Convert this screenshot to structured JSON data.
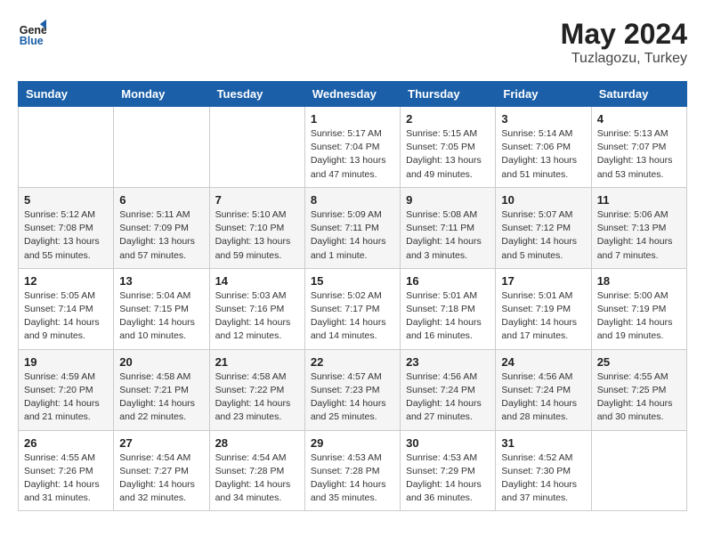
{
  "header": {
    "logo_line1": "General",
    "logo_line2": "Blue",
    "month": "May 2024",
    "location": "Tuzlagozu, Turkey"
  },
  "weekdays": [
    "Sunday",
    "Monday",
    "Tuesday",
    "Wednesday",
    "Thursday",
    "Friday",
    "Saturday"
  ],
  "weeks": [
    [
      {
        "day": "",
        "sunrise": "",
        "sunset": "",
        "daylight": ""
      },
      {
        "day": "",
        "sunrise": "",
        "sunset": "",
        "daylight": ""
      },
      {
        "day": "",
        "sunrise": "",
        "sunset": "",
        "daylight": ""
      },
      {
        "day": "1",
        "sunrise": "Sunrise: 5:17 AM",
        "sunset": "Sunset: 7:04 PM",
        "daylight": "Daylight: 13 hours and 47 minutes."
      },
      {
        "day": "2",
        "sunrise": "Sunrise: 5:15 AM",
        "sunset": "Sunset: 7:05 PM",
        "daylight": "Daylight: 13 hours and 49 minutes."
      },
      {
        "day": "3",
        "sunrise": "Sunrise: 5:14 AM",
        "sunset": "Sunset: 7:06 PM",
        "daylight": "Daylight: 13 hours and 51 minutes."
      },
      {
        "day": "4",
        "sunrise": "Sunrise: 5:13 AM",
        "sunset": "Sunset: 7:07 PM",
        "daylight": "Daylight: 13 hours and 53 minutes."
      }
    ],
    [
      {
        "day": "5",
        "sunrise": "Sunrise: 5:12 AM",
        "sunset": "Sunset: 7:08 PM",
        "daylight": "Daylight: 13 hours and 55 minutes."
      },
      {
        "day": "6",
        "sunrise": "Sunrise: 5:11 AM",
        "sunset": "Sunset: 7:09 PM",
        "daylight": "Daylight: 13 hours and 57 minutes."
      },
      {
        "day": "7",
        "sunrise": "Sunrise: 5:10 AM",
        "sunset": "Sunset: 7:10 PM",
        "daylight": "Daylight: 13 hours and 59 minutes."
      },
      {
        "day": "8",
        "sunrise": "Sunrise: 5:09 AM",
        "sunset": "Sunset: 7:11 PM",
        "daylight": "Daylight: 14 hours and 1 minute."
      },
      {
        "day": "9",
        "sunrise": "Sunrise: 5:08 AM",
        "sunset": "Sunset: 7:11 PM",
        "daylight": "Daylight: 14 hours and 3 minutes."
      },
      {
        "day": "10",
        "sunrise": "Sunrise: 5:07 AM",
        "sunset": "Sunset: 7:12 PM",
        "daylight": "Daylight: 14 hours and 5 minutes."
      },
      {
        "day": "11",
        "sunrise": "Sunrise: 5:06 AM",
        "sunset": "Sunset: 7:13 PM",
        "daylight": "Daylight: 14 hours and 7 minutes."
      }
    ],
    [
      {
        "day": "12",
        "sunrise": "Sunrise: 5:05 AM",
        "sunset": "Sunset: 7:14 PM",
        "daylight": "Daylight: 14 hours and 9 minutes."
      },
      {
        "day": "13",
        "sunrise": "Sunrise: 5:04 AM",
        "sunset": "Sunset: 7:15 PM",
        "daylight": "Daylight: 14 hours and 10 minutes."
      },
      {
        "day": "14",
        "sunrise": "Sunrise: 5:03 AM",
        "sunset": "Sunset: 7:16 PM",
        "daylight": "Daylight: 14 hours and 12 minutes."
      },
      {
        "day": "15",
        "sunrise": "Sunrise: 5:02 AM",
        "sunset": "Sunset: 7:17 PM",
        "daylight": "Daylight: 14 hours and 14 minutes."
      },
      {
        "day": "16",
        "sunrise": "Sunrise: 5:01 AM",
        "sunset": "Sunset: 7:18 PM",
        "daylight": "Daylight: 14 hours and 16 minutes."
      },
      {
        "day": "17",
        "sunrise": "Sunrise: 5:01 AM",
        "sunset": "Sunset: 7:19 PM",
        "daylight": "Daylight: 14 hours and 17 minutes."
      },
      {
        "day": "18",
        "sunrise": "Sunrise: 5:00 AM",
        "sunset": "Sunset: 7:19 PM",
        "daylight": "Daylight: 14 hours and 19 minutes."
      }
    ],
    [
      {
        "day": "19",
        "sunrise": "Sunrise: 4:59 AM",
        "sunset": "Sunset: 7:20 PM",
        "daylight": "Daylight: 14 hours and 21 minutes."
      },
      {
        "day": "20",
        "sunrise": "Sunrise: 4:58 AM",
        "sunset": "Sunset: 7:21 PM",
        "daylight": "Daylight: 14 hours and 22 minutes."
      },
      {
        "day": "21",
        "sunrise": "Sunrise: 4:58 AM",
        "sunset": "Sunset: 7:22 PM",
        "daylight": "Daylight: 14 hours and 23 minutes."
      },
      {
        "day": "22",
        "sunrise": "Sunrise: 4:57 AM",
        "sunset": "Sunset: 7:23 PM",
        "daylight": "Daylight: 14 hours and 25 minutes."
      },
      {
        "day": "23",
        "sunrise": "Sunrise: 4:56 AM",
        "sunset": "Sunset: 7:24 PM",
        "daylight": "Daylight: 14 hours and 27 minutes."
      },
      {
        "day": "24",
        "sunrise": "Sunrise: 4:56 AM",
        "sunset": "Sunset: 7:24 PM",
        "daylight": "Daylight: 14 hours and 28 minutes."
      },
      {
        "day": "25",
        "sunrise": "Sunrise: 4:55 AM",
        "sunset": "Sunset: 7:25 PM",
        "daylight": "Daylight: 14 hours and 30 minutes."
      }
    ],
    [
      {
        "day": "26",
        "sunrise": "Sunrise: 4:55 AM",
        "sunset": "Sunset: 7:26 PM",
        "daylight": "Daylight: 14 hours and 31 minutes."
      },
      {
        "day": "27",
        "sunrise": "Sunrise: 4:54 AM",
        "sunset": "Sunset: 7:27 PM",
        "daylight": "Daylight: 14 hours and 32 minutes."
      },
      {
        "day": "28",
        "sunrise": "Sunrise: 4:54 AM",
        "sunset": "Sunset: 7:28 PM",
        "daylight": "Daylight: 14 hours and 34 minutes."
      },
      {
        "day": "29",
        "sunrise": "Sunrise: 4:53 AM",
        "sunset": "Sunset: 7:28 PM",
        "daylight": "Daylight: 14 hours and 35 minutes."
      },
      {
        "day": "30",
        "sunrise": "Sunrise: 4:53 AM",
        "sunset": "Sunset: 7:29 PM",
        "daylight": "Daylight: 14 hours and 36 minutes."
      },
      {
        "day": "31",
        "sunrise": "Sunrise: 4:52 AM",
        "sunset": "Sunset: 7:30 PM",
        "daylight": "Daylight: 14 hours and 37 minutes."
      },
      {
        "day": "",
        "sunrise": "",
        "sunset": "",
        "daylight": ""
      }
    ]
  ]
}
